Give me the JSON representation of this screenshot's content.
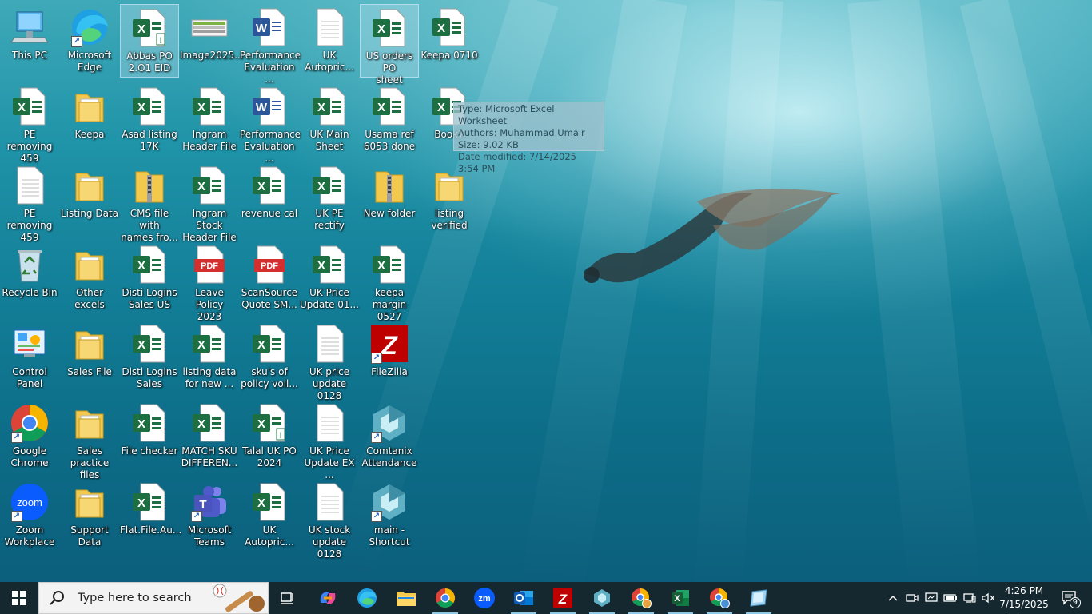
{
  "desktop": {
    "tooltip": {
      "type": "Type: Microsoft Excel Worksheet",
      "authors": "Authors: Muhammad Umair",
      "size": "Size: 9.02 KB",
      "modified": "Date modified: 7/14/2025 3:54 PM"
    },
    "icons": {
      "this_pc": "This PC",
      "edge": "Microsoft\nEdge",
      "abbas_po": "Abbas PO\n2.O1  EID",
      "image2025": "Image2025...",
      "perf_eval_1": "Performance\nEvaluation ...",
      "uk_autopric_1": "UK\nAutopric...",
      "us_orders": "US orders PO\nsheet",
      "keepa_0710": "Keepa 0710",
      "pe_removing_1": "PE removing\n459",
      "keepa_folder": "Keepa",
      "asad_listing": "Asad listing\n17K",
      "ingram_header": "Ingram\nHeader File",
      "perf_eval_2": "Performance\nEvaluation ...",
      "uk_main": "UK Main\nSheet",
      "usama_ref": "Usama ref\n6053 done",
      "book7": "Book7",
      "pe_removing_2": "PE removing\n459",
      "listing_data": "Listing Data",
      "cms_file": "CMS file with\nnames fro...",
      "ingram_stock": "Ingram Stock\nHeader File",
      "revenue_cal": "revenue cal",
      "uk_pe_rectify": "UK PE rectify",
      "new_folder": "New folder",
      "listing_verified": "listing\nverified",
      "recycle_bin": "Recycle Bin",
      "other_excels": "Other excels",
      "disti_logins_us": "Disti Logins\nSales US",
      "leave_policy": "Leave Policy\n2023",
      "scansource": "ScanSource\nQuote SM...",
      "uk_price_update_01": "UK Price\nUpdate 01...",
      "keepa_margin": "keepa\nmargin 0527",
      "control_panel": "Control\nPanel",
      "sales_file": "Sales File",
      "disti_logins_sales": "Disti Logins\nSales",
      "listing_data_new": "listing data\nfor new ...",
      "skus_policy": "sku's of\npolicy voil...",
      "uk_price_update_0128": "UK price\nupdate 0128",
      "filezilla": "FileZilla",
      "chrome": "Google\nChrome",
      "sales_practice": "Sales practice\nfiles",
      "file_checker": "File checker",
      "match_sku": "MATCH SKU\nDIFFEREN...",
      "talal_uk": "Talal UK PO\n2024",
      "uk_price_update_ex": "UK Price\nUpdate EX ...",
      "comtanix": "Comtanix\nAttendance",
      "zoom": "Zoom\nWorkplace",
      "support_data": "Support Data",
      "flat_file": "Flat.File.Au...",
      "teams": "Microsoft\nTeams",
      "uk_autopric_2": "UK\nAutopric...",
      "uk_stock_update": "UK stock\nupdate 0128",
      "main_shortcut": "main -\nShortcut"
    },
    "glyph_labels": {
      "excel": "X",
      "word": "W",
      "pdf": "PDF",
      "zoom": "zoom",
      "filezilla": "Z",
      "shortcut_arrow": "↗"
    }
  },
  "taskbar": {
    "search_placeholder": "Type here to search",
    "zoom_label": "zm",
    "notification_count": "9",
    "clock_time": "4:26 PM",
    "clock_date": "7/15/2025"
  },
  "colors": {
    "excel": "#1d6f42",
    "word": "#2b579a",
    "pdf": "#d32f2f",
    "folder": "#f2c94c",
    "taskbar": "#15282f"
  }
}
